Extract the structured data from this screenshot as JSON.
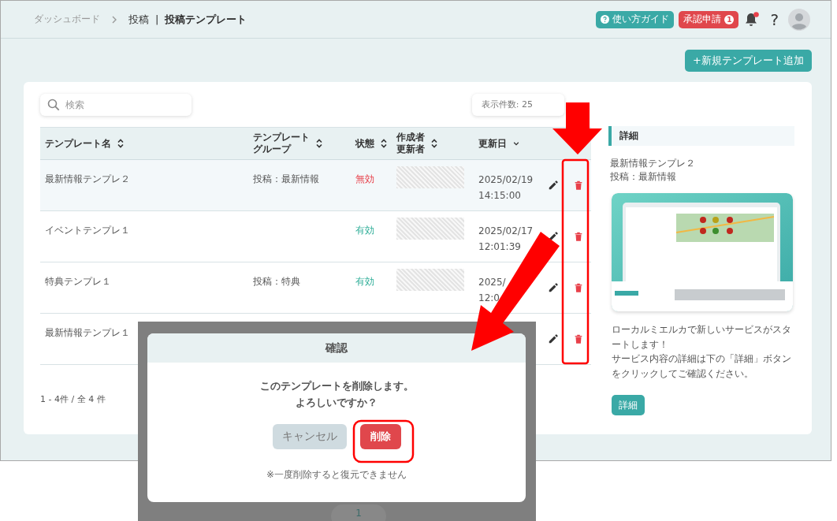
{
  "breadcrumb": {
    "items": [
      "ダッシュボード",
      "投稿"
    ],
    "separator": "|",
    "current": "投稿テンプレート"
  },
  "header": {
    "guide_button": "使い方ガイド",
    "approval_button": "承認申請",
    "approval_count": "1",
    "notifications_unread": true,
    "help": "?"
  },
  "add_button": "+新規テンプレート追加",
  "search": {
    "placeholder": "検索"
  },
  "page_size": "表示件数: 25",
  "table": {
    "columns": [
      {
        "label": [
          "テンプレート名"
        ],
        "sorted": false
      },
      {
        "label": [
          "テンプレート",
          "グループ"
        ],
        "sorted": false
      },
      {
        "label": [
          "状態"
        ],
        "sorted": false
      },
      {
        "label": [
          "作成者",
          "更新者"
        ],
        "sorted": false
      },
      {
        "label": [
          "更新日"
        ],
        "sorted": true
      }
    ],
    "rows": [
      {
        "name": "最新情報テンプレ２",
        "group": "投稿：最新情報",
        "status": "無効",
        "active": false,
        "date": "2025/02/19",
        "time": "14:15:00",
        "selected": true,
        "author_redacted": true
      },
      {
        "name": "イベントテンプレ１",
        "status": "有効",
        "active": true,
        "date": "2025/02/17",
        "time": "12:01:39",
        "selected": false,
        "author_redacted": true
      },
      {
        "name": "特典テンプレ１",
        "group": "投稿：特典",
        "status": "有効",
        "active": true,
        "date": "2025/",
        "time": "12:0",
        "selected": false,
        "author_redacted": true
      },
      {
        "name": "最新情報テンプレ１",
        "selected": false
      }
    ]
  },
  "table_footer": "1 - 4件 / 全 4 件",
  "detail": {
    "title": "詳細",
    "name": "最新情報テンプレ２",
    "group": "投稿：最新情報",
    "description": [
      "ローカルミエルカで新しいサービスがスタートします！",
      "サービス内容の詳細は下の「詳細」ボタンをクリックしてご確認ください。"
    ],
    "button": "詳細"
  },
  "dialog": {
    "title": "確認",
    "message": [
      "このテンプレートを削除します。",
      "よろしいですか？"
    ],
    "cancel": "キャンセル",
    "confirm": "削除",
    "note": "※一度削除すると復元できません",
    "page": "1"
  }
}
